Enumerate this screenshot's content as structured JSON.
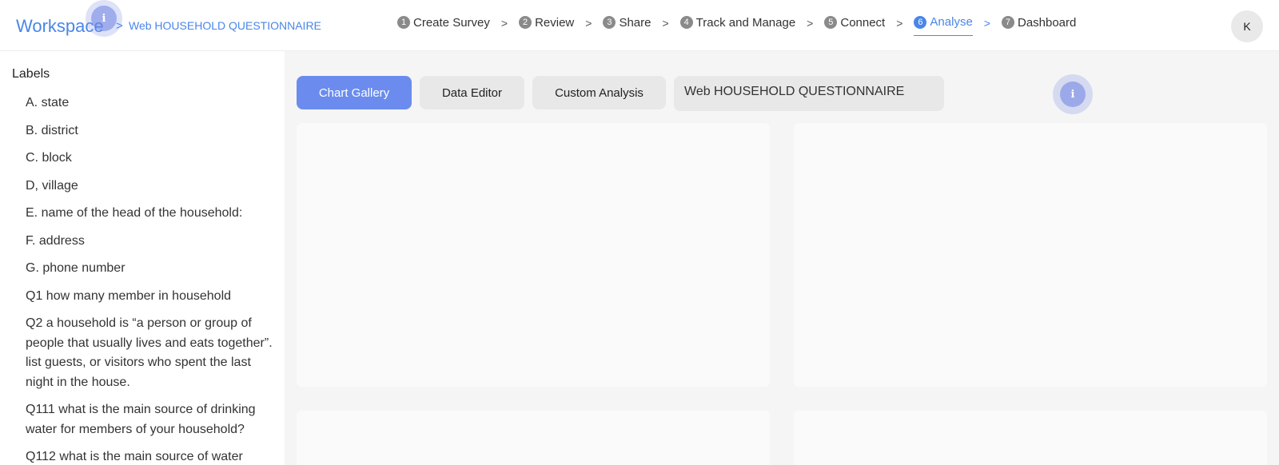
{
  "header": {
    "workspace_label": "Workspace",
    "breadcrumb_sep": ">",
    "survey_name": "Web HOUSEHOLD QUESTIONNAIRE",
    "info_glyph": "i",
    "steps": [
      {
        "num": "1",
        "label": "Create Survey"
      },
      {
        "num": "2",
        "label": "Review"
      },
      {
        "num": "3",
        "label": "Share"
      },
      {
        "num": "4",
        "label": "Track and Manage"
      },
      {
        "num": "5",
        "label": "Connect"
      },
      {
        "num": "6",
        "label": "Analyse",
        "active": true
      },
      {
        "num": "7",
        "label": "Dashboard"
      }
    ],
    "step_sep": ">",
    "avatar_initial": "K",
    "accent_color": "#4a86e8"
  },
  "sidebar": {
    "title": "Labels",
    "items": [
      "A. state",
      "B. district",
      "C. block",
      "D, village",
      "E. name of the head of the household:",
      "F. address",
      "G. phone number",
      "Q1 how many member in household",
      "Q2 a household is “a person or group of people that usually lives and eats together”. list guests, or visitors who spent the last night in the house.",
      "Q111 what is the main source of drinking water for members of your household?",
      "Q112 what is the main source of water"
    ]
  },
  "toolbar": {
    "chart_gallery": "Chart Gallery",
    "data_editor": "Data Editor",
    "custom_analysis": "Custom Analysis",
    "survey_field_value": "Web HOUSEHOLD QUESTIONNAIRE",
    "primary_color": "#6b8cee"
  }
}
